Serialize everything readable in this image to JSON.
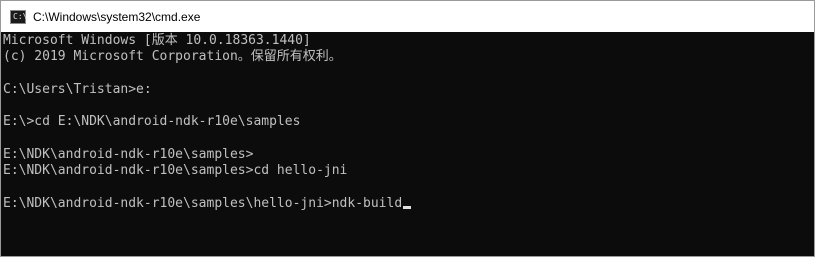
{
  "window": {
    "title": "C:\\Windows\\system32\\cmd.exe",
    "icon": "cmd-icon",
    "icon_glyph": "C:\\"
  },
  "console": {
    "lines": [
      "Microsoft Windows [版本 10.0.18363.1440]",
      "(c) 2019 Microsoft Corporation。保留所有权利。",
      "",
      "C:\\Users\\Tristan>e:",
      "",
      "E:\\>cd E:\\NDK\\android-ndk-r10e\\samples",
      "",
      "E:\\NDK\\android-ndk-r10e\\samples>",
      "E:\\NDK\\android-ndk-r10e\\samples>cd hello-jni",
      "",
      "E:\\NDK\\android-ndk-r10e\\samples\\hello-jni>ndk-build"
    ]
  },
  "colors": {
    "console_bg": "#0c0c0c",
    "console_fg": "#c0c0c0",
    "titlebar_bg": "#ffffff"
  }
}
